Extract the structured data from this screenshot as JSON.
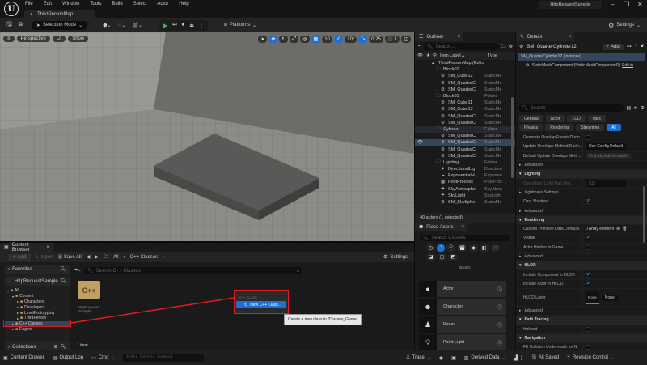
{
  "menu": [
    "File",
    "Edit",
    "Window",
    "Tools",
    "Build",
    "Select",
    "Actor",
    "Help"
  ],
  "document_tab": "ThirdPersonMap",
  "project_name": "HttpRequestSample",
  "toolbar": {
    "selection_mode": "Selection Mode",
    "platforms": "Platforms",
    "settings": "Settings"
  },
  "viewport": {
    "perspective": "Perspective",
    "lit": "Lit",
    "show": "Show",
    "grid_snap": "10",
    "rotation_snap": "10°",
    "scale_snap": "0.25",
    "camera_speed": "1"
  },
  "outliner": {
    "title": "Outliner",
    "search_placeholder": "Search...",
    "col_label": "Item Label ▴",
    "col_type": "Type",
    "rows": [
      {
        "label": "ThirdPersonMap (Editor)",
        "type": "",
        "indent": 1,
        "kind": "map"
      },
      {
        "label": "Block02",
        "type": "",
        "indent": 2,
        "kind": "folder"
      },
      {
        "label": "SM_Cube12",
        "type": "StaticMe",
        "indent": 3,
        "kind": "mesh"
      },
      {
        "label": "SM_QuarterC",
        "type": "StaticMe",
        "indent": 3,
        "kind": "mesh"
      },
      {
        "label": "SM_QuarterC",
        "type": "StaticMe",
        "indent": 3,
        "kind": "mesh"
      },
      {
        "label": "Block03",
        "type": "Folder",
        "indent": 2,
        "kind": "folder"
      },
      {
        "label": "SM_Cube11",
        "type": "StaticMe",
        "indent": 3,
        "kind": "mesh"
      },
      {
        "label": "SM_Cube13",
        "type": "StaticMe",
        "indent": 3,
        "kind": "mesh"
      },
      {
        "label": "SM_QuarterC",
        "type": "StaticMe",
        "indent": 3,
        "kind": "mesh"
      },
      {
        "label": "SM_QuarterC",
        "type": "StaticMe",
        "indent": 3,
        "kind": "mesh"
      },
      {
        "label": "Cylinder",
        "type": "Folder",
        "indent": 2,
        "kind": "folder",
        "state": "fold"
      },
      {
        "label": "SM_QuarterC",
        "type": "StaticMe",
        "indent": 3,
        "kind": "mesh"
      },
      {
        "label": "SM_QuarterC",
        "type": "StaticMe",
        "indent": 3,
        "kind": "mesh",
        "state": "sel"
      },
      {
        "label": "SM_QuarterC",
        "type": "StaticMe",
        "indent": 3,
        "kind": "mesh"
      },
      {
        "label": "SM_QuarterC",
        "type": "StaticMe",
        "indent": 3,
        "kind": "mesh"
      },
      {
        "label": "Lighting",
        "type": "Folder",
        "indent": 2,
        "kind": "folder"
      },
      {
        "label": "DirectionalLig",
        "type": "Direction",
        "indent": 3,
        "kind": "light"
      },
      {
        "label": "ExponentialH",
        "type": "Exponen",
        "indent": 3,
        "kind": "fog"
      },
      {
        "label": "PostProcess",
        "type": "PostProc",
        "indent": 3,
        "kind": "pp"
      },
      {
        "label": "SkyAtmosphe",
        "type": "SkyAtmo",
        "indent": 3,
        "kind": "sky"
      },
      {
        "label": "SkyLight",
        "type": "SkyLight",
        "indent": 3,
        "kind": "sky"
      },
      {
        "label": "SM_SkySphe",
        "type": "StaticMe",
        "indent": 3,
        "kind": "mesh"
      }
    ],
    "footer": "40 actors (1 selected)"
  },
  "details": {
    "title": "Details",
    "actor": "SM_QuarterCylinder12",
    "add": "Add",
    "instance": "SM_QuarterCylinder12 (Instance)",
    "component": "StaticMeshComponent (StaticMeshComponent0)",
    "edit_in": "Edit in",
    "search_placeholder": "Search",
    "categories": [
      "General",
      "Actor",
      "LOD",
      "Misc",
      "Physics",
      "Rendering",
      "Streaming",
      "All"
    ],
    "rows": [
      {
        "t": "prop",
        "k": "Generate Overlap Events Durin...",
        "v": "chk0"
      },
      {
        "t": "prop",
        "k": "Update Overlaps Method Durin...",
        "v": "Use Config Default"
      },
      {
        "t": "prop",
        "k": "Default Update Overlaps Meth...",
        "v": "Only Update Movable"
      },
      {
        "t": "adv",
        "k": "Advanced"
      },
      {
        "t": "sec",
        "k": "Lighting"
      },
      {
        "t": "prop",
        "k": "Overridden Light Map Res",
        "v": "512"
      },
      {
        "t": "adv",
        "k": "Lightmass Settings"
      },
      {
        "t": "prop",
        "k": "Cast Shadow",
        "v": "chk1"
      },
      {
        "t": "adv",
        "k": "Advanced"
      },
      {
        "t": "sec",
        "k": "Rendering"
      },
      {
        "t": "prop",
        "k": "Custom Primitive Data Defaults",
        "v": "0 Array element"
      },
      {
        "t": "prop",
        "k": "Visible",
        "v": "chk1"
      },
      {
        "t": "prop",
        "k": "Actor Hidden In Game",
        "v": "chk0"
      },
      {
        "t": "adv",
        "k": "Advanced"
      },
      {
        "t": "sec",
        "k": "HLOD"
      },
      {
        "t": "prop",
        "k": "Include Component in HLOD",
        "v": "chk1"
      },
      {
        "t": "prop",
        "k": "Include Actor in HLOD",
        "v": "chk1"
      },
      {
        "t": "hlod",
        "k": "HLOD Layer",
        "v": "None",
        "thumb": "None"
      },
      {
        "t": "adv",
        "k": "Advanced"
      },
      {
        "t": "sec",
        "k": "Path Tracing"
      },
      {
        "t": "prop",
        "k": "Holdout",
        "v": "chk0"
      },
      {
        "t": "sec",
        "k": "Navigation"
      },
      {
        "t": "prop",
        "k": "Fill Collision Underneath for N",
        "v": "chk0"
      }
    ]
  },
  "content_browser": {
    "title": "Content Browser",
    "add": "Add",
    "import": "Import",
    "save_all": "Save All",
    "path": [
      "All",
      "C++ Classes"
    ],
    "settings": "Settings",
    "search_placeholder": "Search C++ Classes",
    "favorites": "Favorites",
    "project": "HttpRequestSample",
    "tree": [
      {
        "label": "All",
        "indent": 0
      },
      {
        "label": "Content",
        "indent": 1
      },
      {
        "label": "Characters",
        "indent": 2
      },
      {
        "label": "Developers",
        "indent": 2
      },
      {
        "label": "LevelPrototyping",
        "indent": 2
      },
      {
        "label": "ThirdPerson",
        "indent": 2
      },
      {
        "label": "C++ Classes",
        "indent": 1,
        "selected": true
      },
      {
        "label": "Engine",
        "indent": 1
      }
    ],
    "collections": "Collections",
    "folder_tile": "HttpRequest Sample",
    "folder_glyph": "C++",
    "item_count": "1 item",
    "context_menu": {
      "header": "C++ CLASS",
      "item": "New C++ Class..."
    },
    "tooltip": "Create a new class in /Classes_Game."
  },
  "place_actors": {
    "title": "Place Actors",
    "search_placeholder": "Search Classes",
    "section": "BASIC",
    "items": [
      {
        "label": "Actor",
        "icon": "sphere"
      },
      {
        "label": "Character",
        "icon": "character"
      },
      {
        "label": "Pawn",
        "icon": "pawn"
      },
      {
        "label": "Point Light",
        "icon": "bulb"
      }
    ]
  },
  "status": {
    "content_drawer": "Content Drawer",
    "output_log": "Output Log",
    "cmd": "Cmd",
    "console_placeholder": "Enter Console Command",
    "trace": "Trace",
    "derived_data": "Derived Data",
    "all_saved": "All Saved",
    "revision_control": "Revision Control"
  },
  "colors": {
    "accent": "#1e6fd0",
    "annotation": "#e01b24",
    "folder": "#c8a060"
  }
}
